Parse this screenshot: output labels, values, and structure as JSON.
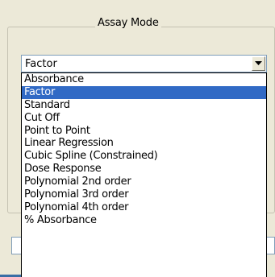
{
  "groupbox": {
    "title": "Assay Mode"
  },
  "combo": {
    "selected_value": "Factor"
  },
  "dropdown": {
    "selected_index": 1,
    "items": [
      "Absorbance",
      "Factor",
      "Standard",
      "Cut Off",
      "Point to Point",
      "Linear Regression",
      "Cubic Spline (Constrained)",
      "Dose Response",
      "Polynomial 2nd order",
      "Polynomial 3rd order",
      "Polynomial 4th order",
      "% Absorbance"
    ]
  },
  "colors": {
    "selection": "#316ac5",
    "panel": "#ece9d8"
  }
}
